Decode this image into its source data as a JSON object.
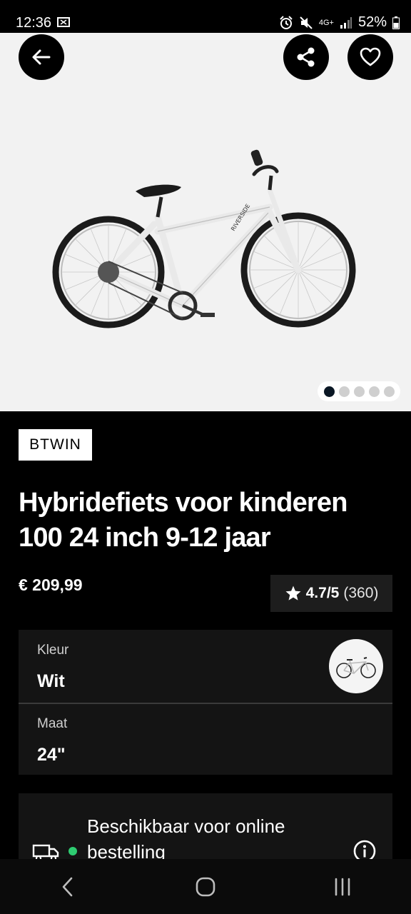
{
  "status_bar": {
    "time": "12:36",
    "battery": "52%",
    "network": "4G+"
  },
  "gallery": {
    "dot_count": 5,
    "active_index": 0,
    "frame_brand_text": "RIVERSIDE"
  },
  "product": {
    "brand": "BTWIN",
    "title_line1": "Hybridefiets voor kinderen",
    "title_line2": "100 24 inch 9-12 jaar",
    "price": "€ 209,99",
    "rating_score": "4.7/5",
    "rating_count": "(360)"
  },
  "options": {
    "color_label": "Kleur",
    "color_value": "Wit",
    "size_label": "Maat",
    "size_value": "24\""
  },
  "availability": {
    "text": "Beschikbaar voor online bestelling",
    "status_color": "#2ecc71"
  },
  "icons": {
    "back": "arrow-left-icon",
    "share": "share-icon",
    "favorite": "heart-icon",
    "star": "star-icon",
    "truck": "truck-icon",
    "info": "info-icon"
  }
}
